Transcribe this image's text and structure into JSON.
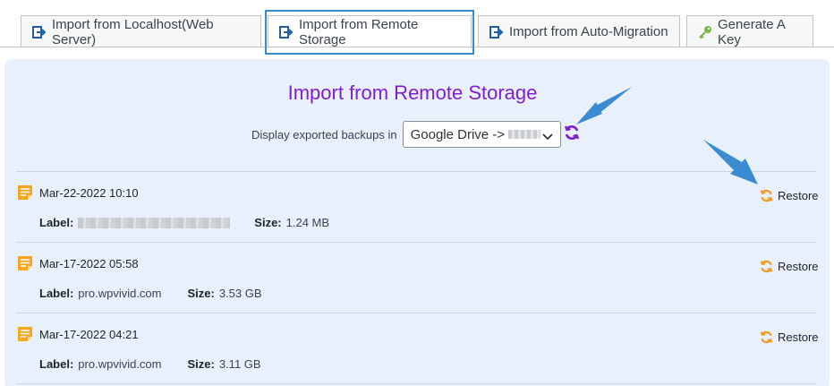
{
  "tabs": [
    {
      "label": "Import from Localhost(Web Server)",
      "icon": "import-arrow-icon",
      "active": false
    },
    {
      "label": "Import from Remote Storage",
      "icon": "import-arrow-icon",
      "active": true
    },
    {
      "label": "Import from Auto-Migration",
      "icon": "import-arrow-icon",
      "active": false
    },
    {
      "label": "Generate A Key",
      "icon": "key-icon",
      "active": false
    }
  ],
  "panel": {
    "title": "Import from Remote Storage",
    "filter_label": "Display exported backups in",
    "select_value": "Google Drive ->",
    "refresh_icon": "refresh-icon"
  },
  "backups": [
    {
      "date": "Mar-22-2022 10:10",
      "label_key": "Label:",
      "label_value": "",
      "size_key": "Size:",
      "size_value": "1.24 MB",
      "action": "Restore"
    },
    {
      "date": "Mar-17-2022 05:58",
      "label_key": "Label:",
      "label_value": "pro.wpvivid.com",
      "size_key": "Size:",
      "size_value": "3.53 GB",
      "action": "Restore"
    },
    {
      "date": "Mar-17-2022 04:21",
      "label_key": "Label:",
      "label_value": "pro.wpvivid.com",
      "size_key": "Size:",
      "size_value": "3.11 GB",
      "action": "Restore"
    }
  ],
  "colors": {
    "accent_purple": "#7e1fd1",
    "restore_orange": "#f59a23",
    "doc_icon_orange": "#f5a623",
    "panel_bg": "#e8f0fc",
    "annotation_blue": "#3a8bd2"
  }
}
